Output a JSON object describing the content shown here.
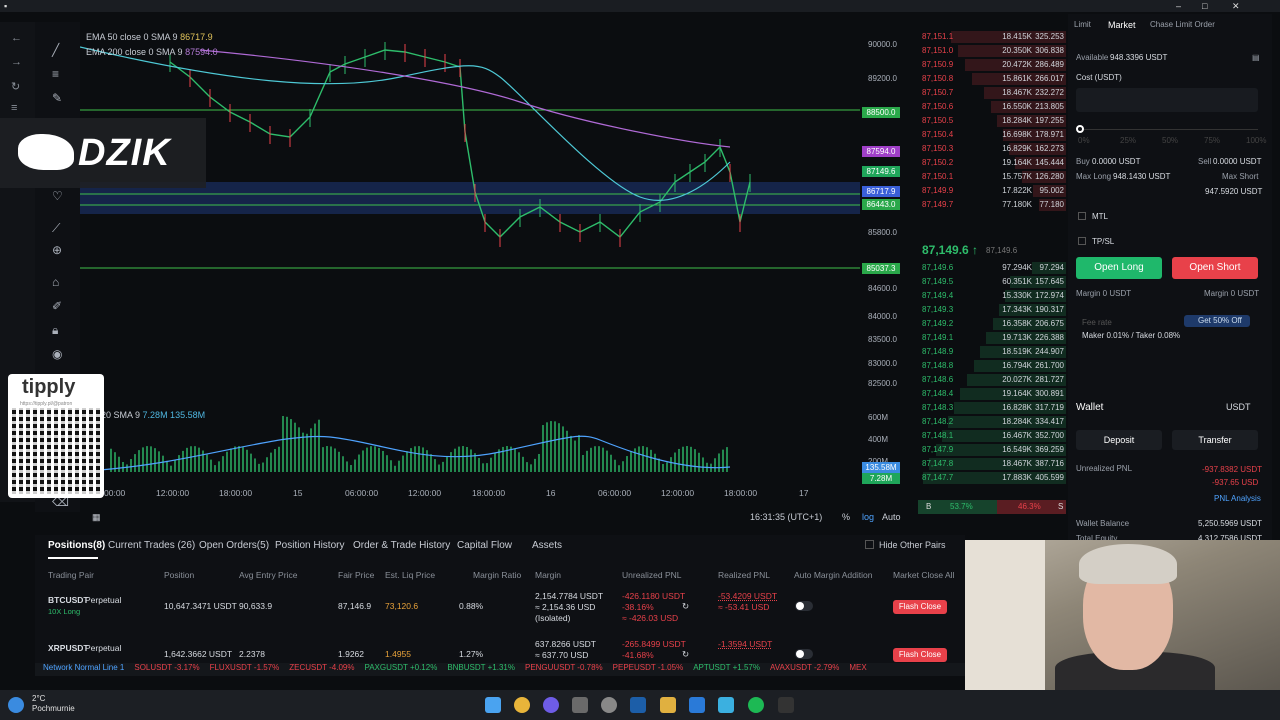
{
  "chart": {
    "ema50_label": "EMA 50 close 0 SMA 9",
    "ema50_value": "86717.9",
    "ema200_label": "EMA 200 close 0 SMA 9",
    "ema200_value": "87594.0",
    "volume_label": "me 20 SMA 9",
    "volume_value": "7.28M  135.58M",
    "price_ticks": [
      "90000.0",
      "89200.0",
      "88500.0",
      "87594.0",
      "87149.6",
      "86717.9",
      "86443.0",
      "85800.0",
      "85037.3",
      "84600.0",
      "84000.0",
      "83500.0",
      "83000.0",
      "82500.0"
    ],
    "volume_ticks": [
      "600M",
      "400M",
      "200M",
      "135.58M",
      "7.28M"
    ],
    "x_ticks": [
      "00:00",
      "12:00:00",
      "18:00:00",
      "15",
      "06:00:00",
      "12:00:00",
      "18:00:00",
      "16",
      "06:00:00",
      "12:00:00",
      "18:00:00",
      "17"
    ],
    "clock": "16:31:35 (UTC+1)",
    "scale_pct": "%",
    "scale_log": "log",
    "scale_auto": "Auto",
    "chart_data": {
      "type": "line",
      "title": "",
      "series": [
        {
          "name": "EMA 50 close 0 SMA 9",
          "values": []
        },
        {
          "name": "EMA 200 close 0 SMA 9",
          "values": []
        }
      ],
      "ylim": [
        82300,
        90300
      ]
    }
  },
  "overlays": {
    "brand": "DZIK",
    "tipply": "tipply",
    "tipply_url": "https://tipply.pl/@patron"
  },
  "orderbook": {
    "asks": [
      [
        "87,151.1",
        "18.415K",
        "325.253"
      ],
      [
        "87,151.0",
        "20.350K",
        "306.838"
      ],
      [
        "87,150.9",
        "20.472K",
        "286.489"
      ],
      [
        "87,150.8",
        "15.861K",
        "266.017"
      ],
      [
        "87,150.7",
        "18.467K",
        "232.272"
      ],
      [
        "87,150.6",
        "16.550K",
        "213.805"
      ],
      [
        "87,150.5",
        "18.284K",
        "197.255"
      ],
      [
        "87,150.4",
        "16.698K",
        "178.971"
      ],
      [
        "87,150.3",
        "16.829K",
        "162.273"
      ],
      [
        "87,150.2",
        "19.164K",
        "145.444"
      ],
      [
        "87,150.1",
        "15.757K",
        "126.280"
      ],
      [
        "87,149.9",
        "17.822K",
        "95.002"
      ],
      [
        "87,149.7",
        "77.180K",
        "77.180"
      ]
    ],
    "mid_price": "87,149.6 ↑",
    "mid_mark": "87,149.6",
    "bids": [
      [
        "87,149.6",
        "97.294K",
        "97.294"
      ],
      [
        "87,149.5",
        "60.351K",
        "157.645"
      ],
      [
        "87,149.4",
        "15.330K",
        "172.974"
      ],
      [
        "87,149.3",
        "17.343K",
        "190.317"
      ],
      [
        "87,149.2",
        "16.358K",
        "206.675"
      ],
      [
        "87,149.1",
        "19.713K",
        "226.388"
      ],
      [
        "87,148.9",
        "18.519K",
        "244.907"
      ],
      [
        "87,148.8",
        "16.794K",
        "261.700"
      ],
      [
        "87,148.6",
        "20.027K",
        "281.727"
      ],
      [
        "87,148.4",
        "19.164K",
        "300.891"
      ],
      [
        "87,148.3",
        "16.828K",
        "317.719"
      ],
      [
        "87,148.2",
        "18.284K",
        "334.417"
      ],
      [
        "87,148.1",
        "16.467K",
        "352.700"
      ],
      [
        "87,147.9",
        "16.549K",
        "369.259"
      ],
      [
        "87,147.8",
        "18.467K",
        "387.716"
      ],
      [
        "87,147.7",
        "17.883K",
        "405.599"
      ]
    ],
    "buy_pct": "53.7%",
    "sell_pct": "46.3%",
    "b_label": "B",
    "s_label": "S"
  },
  "trade": {
    "tab_limit": "Limit",
    "tab_market": "Market",
    "tab_chase": "Chase Limit Order",
    "available_label": "Available",
    "available_value": "948.3396 USDT",
    "cost_label": "Cost (USDT)",
    "slider_marks": [
      "0%",
      "25%",
      "50%",
      "75%",
      "100%"
    ],
    "buy_label": "Buy",
    "buy_value": "0.0000 USDT",
    "sell_label": "Sell",
    "sell_value": "0.0000 USDT",
    "max_long_label": "Max Long",
    "max_long_value": "948.1430 USDT",
    "max_short_label": "Max Short",
    "max_short_value": "947.5920 USDT",
    "mtl": "MTL",
    "tpsl": "TP/SL",
    "open_long": "Open Long",
    "open_short": "Open Short",
    "margin_long": "Margin 0 USDT",
    "margin_short": "Margin 0 USDT",
    "fee_label": "Fee rate",
    "fee_value": "Maker 0.01% / Taker 0.08%",
    "promo": "Get 50% Off",
    "wallet": "Wallet",
    "wallet_ccy": "USDT",
    "deposit": "Deposit",
    "transfer": "Transfer",
    "unrealized_label": "Unrealized PNL",
    "unrealized_value": "-937.8382 USDT",
    "unrealized_value2": "-937.65 USD",
    "pnl_analysis": "PNL Analysis",
    "wallet_balance_label": "Wallet Balance",
    "wallet_balance_value": "5,250.5969 USDT",
    "total_equity_label": "Total Equity",
    "total_equity_value": "4,312.7586 USDT"
  },
  "positions": {
    "tabs": [
      "Positions(8)",
      "Current Trades (26)",
      "Open Orders(5)",
      "Position History",
      "Order & Trade History",
      "Capital Flow",
      "Assets"
    ],
    "hide_other": "Hide Other Pairs",
    "headers": [
      "Trading Pair",
      "Position",
      "Avg Entry Price",
      "Fair Price",
      "Est. Liq Price",
      "Margin Ratio",
      "Margin",
      "Unrealized PNL",
      "Realized PNL",
      "Auto Margin Addition",
      "Market Close All"
    ],
    "rows": [
      {
        "pair": "BTCUSDT",
        "type": "Perpetual",
        "lev": "10X Long",
        "size": "10,647.3471 USDT",
        "entry": "90,633.9",
        "fair": "87,146.9",
        "liq": "73,120.6",
        "ratio": "0.88%",
        "margin": "2,154.7784 USDT",
        "margin2": "≈ 2,154.36 USD",
        "margin3": "(Isolated)",
        "upnl": "-426.1180 USDT",
        "upnl2": "-38.16%",
        "upnl3": "≈ -426.03 USD",
        "rpnl": "-53.4209 USDT",
        "rpnl2": "≈ -53.41 USD",
        "close": "Flash Close"
      },
      {
        "pair": "XRPUSDT",
        "type": "Perpetual",
        "lev": "",
        "size": "1,642.3662 USDT",
        "entry": "2.2378",
        "fair": "1.9262",
        "liq": "1.4955",
        "ratio": "1.27%",
        "margin": "637.8266 USDT",
        "margin2": "≈ 637.70 USD",
        "margin3": "",
        "upnl": "-265.8499 USDT",
        "upnl2": "-41.68%",
        "upnl3": "",
        "rpnl": "-1.3594 USDT",
        "rpnl2": "",
        "close": "Flash Close"
      }
    ],
    "ticker": [
      "Network Normal  Line 1",
      "SOLUSDT -3.17%",
      "FLUXUSDT -1.57%",
      "ZECUSDT -4.09%",
      "PAXGUSDT +0.12%",
      "BNBUSDT +1.31%",
      "PENGUUSDT -0.78%",
      "PEPEUSDT -1.05%",
      "APTUSDT +1.57%",
      "AVAXUSDT -2.79%",
      "MEX"
    ]
  },
  "taskbar": {
    "temp": "2°C",
    "weather": "Pochmurnie"
  }
}
